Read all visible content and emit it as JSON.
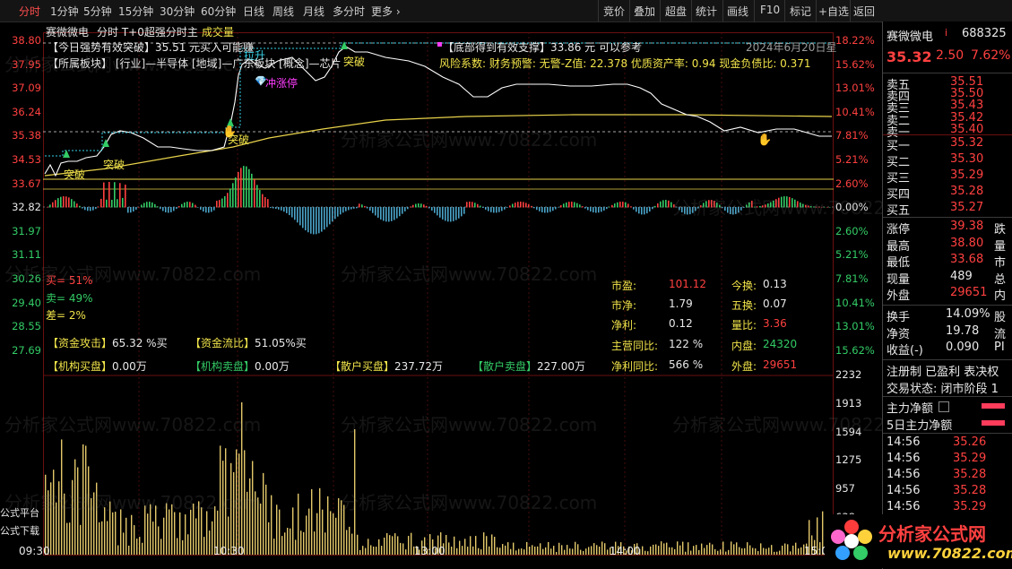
{
  "topbar": {
    "tabs": [
      "分时",
      "1分钟",
      "5分钟",
      "15分钟",
      "30分钟",
      "60分钟",
      "日线",
      "周线",
      "月线",
      "多分时",
      "更多"
    ],
    "more_chevron": "›",
    "tools": [
      "竞价",
      "叠加",
      "超盘",
      "统计",
      "画线",
      "F10",
      "标记",
      "+自选",
      "返回"
    ]
  },
  "chart_header": {
    "stock": "赛微微电",
    "mode": "分时 T+0超强分时主",
    "volume_label": "成交量"
  },
  "indicator_lines": {
    "line1": "【今日强势有效突破】35.51 元买入可能赚",
    "line2": "【所属板块】 [行业]—半导体 [地域]—广东板块 [概念]—芯片",
    "line3": "【底部得到有效支撑】33.86 元 可以参考",
    "line3_prefix": "▪",
    "date": "2024年6月20日星",
    "line4": "风险系数: 财务预警: 无警-Z值: 22.378 优质资产率: 0.94 现金负债比: 0.371"
  },
  "price_axis": [
    "38.80",
    "37.95",
    "37.09",
    "36.24",
    "35.38",
    "34.53",
    "33.67",
    "32.82",
    "31.97",
    "31.11",
    "30.26",
    "29.40",
    "28.55",
    "27.69"
  ],
  "pct_axis": [
    "18.22%",
    "15.62%",
    "13.01%",
    "10.41%",
    "7.81%",
    "5.21%",
    "2.60%",
    "0.00%",
    "2.60%",
    "5.21%",
    "7.81%",
    "10.41%",
    "13.01%",
    "15.62%"
  ],
  "vol_axis": [
    "2232",
    "1913",
    "1594",
    "1275",
    "957",
    "638"
  ],
  "time_axis": [
    "09:30",
    "10:30",
    "13:00",
    "14:00",
    "15:0"
  ],
  "chart_labels": {
    "tupo1": "突破",
    "tupo2": "突破",
    "tupo3": "突破",
    "tupo4": "突破",
    "lashang": "拉升",
    "zhangting": "冲涨停",
    "diamond": "💎"
  },
  "left_stats": {
    "buy": "买= 51%",
    "sell": "卖= 49%",
    "diff": "差= 2%"
  },
  "fund_rows": {
    "attack_k": "【资金攻击】",
    "attack_v": "65.32 %买",
    "flow_k": "【资金流比】",
    "flow_v": "51.05%买",
    "inst_buy_k": "【机构买盘】",
    "inst_buy_v": "0.00万",
    "inst_sell_k": "【机构卖盘】",
    "inst_sell_v": "0.00万",
    "retail_buy_k": "【散户买盘】",
    "retail_buy_v": "237.72万",
    "retail_sell_k": "【散户卖盘】",
    "retail_sell_v": "227.00万"
  },
  "mid_stats": {
    "pe_k": "市盈:",
    "pe_v": "101.12",
    "t4_k": "今换:",
    "t4_v": "0.13",
    "pb_k": "市净:",
    "pb_v": "1.79",
    "t5_k": "五换:",
    "t5_v": "0.07",
    "np_k": "净利:",
    "np_v": "0.12",
    "lb_k": "量比:",
    "lb_v": "3.36",
    "rev_k": "主营同比:",
    "rev_v": "122 %",
    "inner_k": "内盘:",
    "inner_v": "24320",
    "npy_k": "净利同比:",
    "npy_v": "566 %",
    "outer_k": "外盘:",
    "outer_v": "29651"
  },
  "left_bottom": {
    "a": "公式平台",
    "b": "公式下载"
  },
  "quote": {
    "name": "赛微微电",
    "flag": "i",
    "code": "688325",
    "price": "35.32",
    "change": "2.50",
    "pct": "7.62%",
    "asks": [
      {
        "label": "卖五",
        "price": "35.51",
        "vol": ""
      },
      {
        "label": "卖四",
        "price": "35.50",
        "vol": ""
      },
      {
        "label": "卖三",
        "price": "35.43",
        "vol": ""
      },
      {
        "label": "卖二",
        "price": "35.42",
        "vol": ""
      },
      {
        "label": "卖一",
        "price": "35.40",
        "vol": ""
      }
    ],
    "bids": [
      {
        "label": "买一",
        "price": "35.32"
      },
      {
        "label": "买二",
        "price": "35.30"
      },
      {
        "label": "买三",
        "price": "35.29"
      },
      {
        "label": "买四",
        "price": "35.28"
      },
      {
        "label": "买五",
        "price": "35.27"
      }
    ],
    "stats": [
      {
        "k": "涨停",
        "v": "39.38",
        "k2": "跌"
      },
      {
        "k": "最高",
        "v": "38.80",
        "k2": "量"
      },
      {
        "k": "最低",
        "v": "33.68",
        "k2": "市"
      },
      {
        "k": "现量",
        "v": "489",
        "k2": "总"
      },
      {
        "k": "外盘",
        "v": "29651",
        "k2": "内"
      }
    ],
    "stats2": [
      {
        "k": "换手",
        "v": "14.09%",
        "k2": "股"
      },
      {
        "k": "净资",
        "v": "19.78",
        "k2": "流"
      },
      {
        "k": "收益(-)",
        "v": "0.090",
        "k2": "PI"
      }
    ],
    "reg": "注册制 已盈利 表决权",
    "state": "交易状态: 闭市阶段 1",
    "main_net": "主力净额",
    "main_net5": "5日主力净额",
    "ticks": [
      {
        "t": "14:56",
        "p": "35.26"
      },
      {
        "t": "14:56",
        "p": "35.29"
      },
      {
        "t": "14:56",
        "p": "35.28"
      },
      {
        "t": "14:56",
        "p": "35.28"
      },
      {
        "t": "14:56",
        "p": "35.29"
      }
    ]
  },
  "watermarks": {
    "text1": "分析家公式网www.70822.com",
    "logo_main": "分析家公式网",
    "logo_url": "www.70822.com"
  },
  "colors": {
    "up": "#ff4040",
    "down": "#33cc66",
    "price_line": "#ffffff",
    "avg_line": "#e8d24a",
    "vol": "#e3c86a"
  }
}
